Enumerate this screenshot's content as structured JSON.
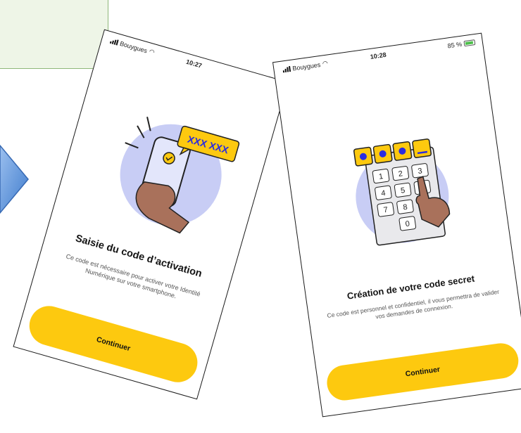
{
  "phones": [
    {
      "status": {
        "carrier": "Bouygues",
        "time": "10:27"
      },
      "illustration": {
        "code_text": "XXX XXX"
      },
      "title": "Saisie du code d’activation",
      "description": "Ce code est nécessaire pour activer votre Identité Numérique sur votre smartphone.",
      "button_label": "Continuer"
    },
    {
      "status": {
        "carrier": "Bouygues",
        "time": "10:28",
        "battery": "85 %"
      },
      "illustration": {
        "keys": [
          "1",
          "2",
          "3",
          "4",
          "5",
          "6",
          "7",
          "8",
          "0"
        ]
      },
      "title": "Création de votre code secret",
      "description": "Ce code est personnel et confidentiel, il vous permettra de valider vos demandes de connexion.",
      "button_label": "Continuer"
    }
  ],
  "colors": {
    "accent_yellow": "#fdc90f",
    "circle_lavender": "#c8cdf5",
    "hand_brown": "#a9715b",
    "code_blue": "#2a2ce0",
    "arrow_blue": "#4f8ad6",
    "note_green": "#eef5e7"
  }
}
